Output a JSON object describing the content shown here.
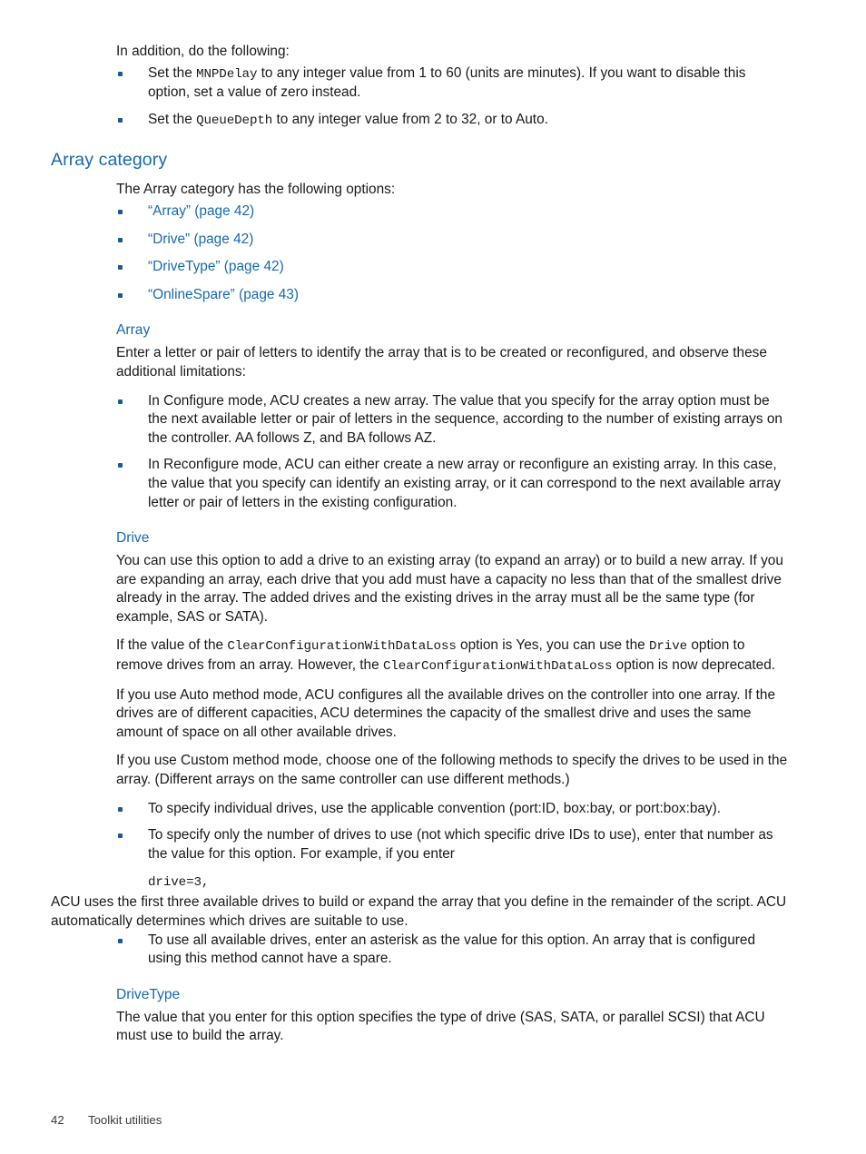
{
  "document": {
    "intro_line": "In addition, do the following:",
    "intro_bullets": [
      {
        "pre": "Set the ",
        "code": "MNPDelay",
        "post": " to any integer value from 1 to 60 (units are minutes). If you want to disable this option, set a value of zero instead."
      },
      {
        "pre": "Set the ",
        "code": "QueueDepth",
        "post": " to any integer value from 2 to 32, or to Auto."
      }
    ]
  },
  "section": {
    "title": "Array category",
    "lead": "The Array category has the following options:",
    "links": [
      "“Array” (page 42)",
      "“Drive” (page 42)",
      "“DriveType” (page 42)",
      "“OnlineSpare” (page 43)"
    ]
  },
  "array": {
    "heading": "Array",
    "intro": "Enter a letter or pair of letters to identify the array that is to be created or reconfigured, and observe these additional limitations:",
    "bullets": [
      "In Configure mode, ACU creates a new array. The value that you specify for the array option must be the next available letter or pair of letters in the sequence, according to the number of existing arrays on the controller. AA follows Z, and BA follows AZ.",
      "In Reconfigure mode, ACU can either create a new array or reconfigure an existing array. In this case, the value that you specify can identify an existing array, or it can correspond to the next available array letter or pair of letters in the existing configuration."
    ]
  },
  "drive": {
    "heading": "Drive",
    "para1": "You can use this option to add a drive to an existing array (to expand an array) or to build a new array. If you are expanding an array, each drive that you add must have a capacity no less than that of the smallest drive already in the array. The added drives and the existing drives in the array must all be the same type (for example, SAS or SATA).",
    "para2": {
      "p1": "If the value of the ",
      "code1": "ClearConfigurationWithDataLoss",
      "p2": " option is Yes, you can use the ",
      "code2": "Drive",
      "p3": " option to remove drives from an array. However, the ",
      "code3": "ClearConfigurationWithDataLoss",
      "p4": " option is now deprecated."
    },
    "para3": "If you use Auto method mode, ACU configures all the available drives on the controller into one array. If the drives are of different capacities, ACU determines the capacity of the smallest drive and uses the same amount of space on all other available drives.",
    "para4": "If you use Custom method mode, choose one of the following methods to specify the drives to be used in the array. (Different arrays on the same controller can use different methods.)",
    "bullet1": "To specify individual drives, use the applicable convention (port:ID, box:bay, or port:box:bay).",
    "bullet2": "To specify only the number of drives to use (not which specific drive IDs to use), enter that number as the value for this option. For example, if you enter",
    "bullet2_code": "drive=3,",
    "bullet2_cont": "ACU uses the first three available drives to build or expand the array that you define in the remainder of the script. ACU automatically determines which drives are suitable to use.",
    "bullet3": "To use all available drives, enter an asterisk as the value for this option. An array that is configured using this method cannot have a spare."
  },
  "drivetype": {
    "heading": "DriveType",
    "para": "The value that you enter for this option specifies the type of drive (SAS, SATA, or parallel SCSI) that ACU must use to build the array."
  },
  "footer": {
    "page_number": "42",
    "chapter_title": "Toolkit utilities"
  },
  "colors": {
    "heading_blue": "#1769ab",
    "link_blue": "#1769ab",
    "bullet_blue": "#1a5a96",
    "body_text": "#1a1a1a"
  }
}
